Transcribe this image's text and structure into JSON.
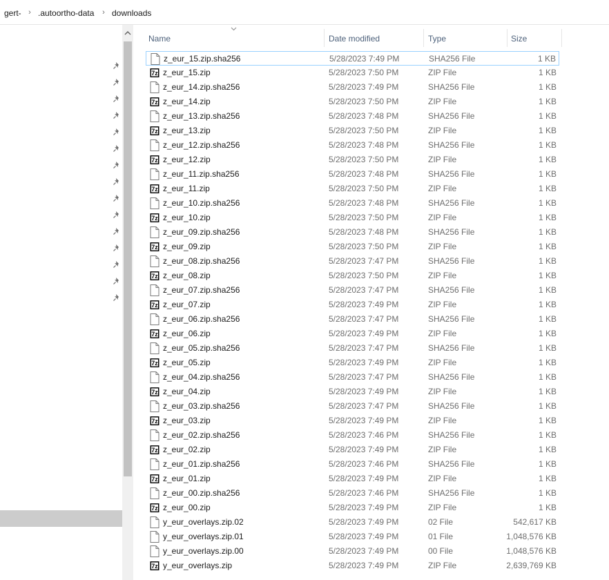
{
  "breadcrumb": [
    "gert-",
    ".autoortho-data",
    "downloads"
  ],
  "columns": {
    "name": "Name",
    "date": "Date modified",
    "type": "Type",
    "size": "Size"
  },
  "files": [
    {
      "name": "z_eur_15.zip.sha256",
      "date": "5/28/2023 7:49 PM",
      "type": "SHA256 File",
      "size": "1 KB",
      "icon": "generic-file-icon"
    },
    {
      "name": "z_eur_15.zip",
      "date": "5/28/2023 7:50 PM",
      "type": "ZIP File",
      "size": "1 KB",
      "icon": "7zip-archive-icon"
    },
    {
      "name": "z_eur_14.zip.sha256",
      "date": "5/28/2023 7:49 PM",
      "type": "SHA256 File",
      "size": "1 KB",
      "icon": "generic-file-icon"
    },
    {
      "name": "z_eur_14.zip",
      "date": "5/28/2023 7:50 PM",
      "type": "ZIP File",
      "size": "1 KB",
      "icon": "7zip-archive-icon"
    },
    {
      "name": "z_eur_13.zip.sha256",
      "date": "5/28/2023 7:48 PM",
      "type": "SHA256 File",
      "size": "1 KB",
      "icon": "generic-file-icon"
    },
    {
      "name": "z_eur_13.zip",
      "date": "5/28/2023 7:50 PM",
      "type": "ZIP File",
      "size": "1 KB",
      "icon": "7zip-archive-icon"
    },
    {
      "name": "z_eur_12.zip.sha256",
      "date": "5/28/2023 7:48 PM",
      "type": "SHA256 File",
      "size": "1 KB",
      "icon": "generic-file-icon"
    },
    {
      "name": "z_eur_12.zip",
      "date": "5/28/2023 7:50 PM",
      "type": "ZIP File",
      "size": "1 KB",
      "icon": "7zip-archive-icon"
    },
    {
      "name": "z_eur_11.zip.sha256",
      "date": "5/28/2023 7:48 PM",
      "type": "SHA256 File",
      "size": "1 KB",
      "icon": "generic-file-icon"
    },
    {
      "name": "z_eur_11.zip",
      "date": "5/28/2023 7:50 PM",
      "type": "ZIP File",
      "size": "1 KB",
      "icon": "7zip-archive-icon"
    },
    {
      "name": "z_eur_10.zip.sha256",
      "date": "5/28/2023 7:48 PM",
      "type": "SHA256 File",
      "size": "1 KB",
      "icon": "generic-file-icon"
    },
    {
      "name": "z_eur_10.zip",
      "date": "5/28/2023 7:50 PM",
      "type": "ZIP File",
      "size": "1 KB",
      "icon": "7zip-archive-icon"
    },
    {
      "name": "z_eur_09.zip.sha256",
      "date": "5/28/2023 7:48 PM",
      "type": "SHA256 File",
      "size": "1 KB",
      "icon": "generic-file-icon"
    },
    {
      "name": "z_eur_09.zip",
      "date": "5/28/2023 7:50 PM",
      "type": "ZIP File",
      "size": "1 KB",
      "icon": "7zip-archive-icon"
    },
    {
      "name": "z_eur_08.zip.sha256",
      "date": "5/28/2023 7:47 PM",
      "type": "SHA256 File",
      "size": "1 KB",
      "icon": "generic-file-icon"
    },
    {
      "name": "z_eur_08.zip",
      "date": "5/28/2023 7:50 PM",
      "type": "ZIP File",
      "size": "1 KB",
      "icon": "7zip-archive-icon"
    },
    {
      "name": "z_eur_07.zip.sha256",
      "date": "5/28/2023 7:47 PM",
      "type": "SHA256 File",
      "size": "1 KB",
      "icon": "generic-file-icon"
    },
    {
      "name": "z_eur_07.zip",
      "date": "5/28/2023 7:49 PM",
      "type": "ZIP File",
      "size": "1 KB",
      "icon": "7zip-archive-icon"
    },
    {
      "name": "z_eur_06.zip.sha256",
      "date": "5/28/2023 7:47 PM",
      "type": "SHA256 File",
      "size": "1 KB",
      "icon": "generic-file-icon"
    },
    {
      "name": "z_eur_06.zip",
      "date": "5/28/2023 7:49 PM",
      "type": "ZIP File",
      "size": "1 KB",
      "icon": "7zip-archive-icon"
    },
    {
      "name": "z_eur_05.zip.sha256",
      "date": "5/28/2023 7:47 PM",
      "type": "SHA256 File",
      "size": "1 KB",
      "icon": "generic-file-icon"
    },
    {
      "name": "z_eur_05.zip",
      "date": "5/28/2023 7:49 PM",
      "type": "ZIP File",
      "size": "1 KB",
      "icon": "7zip-archive-icon"
    },
    {
      "name": "z_eur_04.zip.sha256",
      "date": "5/28/2023 7:47 PM",
      "type": "SHA256 File",
      "size": "1 KB",
      "icon": "generic-file-icon"
    },
    {
      "name": "z_eur_04.zip",
      "date": "5/28/2023 7:49 PM",
      "type": "ZIP File",
      "size": "1 KB",
      "icon": "7zip-archive-icon"
    },
    {
      "name": "z_eur_03.zip.sha256",
      "date": "5/28/2023 7:47 PM",
      "type": "SHA256 File",
      "size": "1 KB",
      "icon": "generic-file-icon"
    },
    {
      "name": "z_eur_03.zip",
      "date": "5/28/2023 7:49 PM",
      "type": "ZIP File",
      "size": "1 KB",
      "icon": "7zip-archive-icon"
    },
    {
      "name": "z_eur_02.zip.sha256",
      "date": "5/28/2023 7:46 PM",
      "type": "SHA256 File",
      "size": "1 KB",
      "icon": "generic-file-icon"
    },
    {
      "name": "z_eur_02.zip",
      "date": "5/28/2023 7:49 PM",
      "type": "ZIP File",
      "size": "1 KB",
      "icon": "7zip-archive-icon"
    },
    {
      "name": "z_eur_01.zip.sha256",
      "date": "5/28/2023 7:46 PM",
      "type": "SHA256 File",
      "size": "1 KB",
      "icon": "generic-file-icon"
    },
    {
      "name": "z_eur_01.zip",
      "date": "5/28/2023 7:49 PM",
      "type": "ZIP File",
      "size": "1 KB",
      "icon": "7zip-archive-icon"
    },
    {
      "name": "z_eur_00.zip.sha256",
      "date": "5/28/2023 7:46 PM",
      "type": "SHA256 File",
      "size": "1 KB",
      "icon": "generic-file-icon"
    },
    {
      "name": "z_eur_00.zip",
      "date": "5/28/2023 7:49 PM",
      "type": "ZIP File",
      "size": "1 KB",
      "icon": "7zip-archive-icon"
    },
    {
      "name": "y_eur_overlays.zip.02",
      "date": "5/28/2023 7:49 PM",
      "type": "02 File",
      "size": "542,617 KB",
      "icon": "generic-file-icon"
    },
    {
      "name": "y_eur_overlays.zip.01",
      "date": "5/28/2023 7:49 PM",
      "type": "01 File",
      "size": "1,048,576 KB",
      "icon": "generic-file-icon"
    },
    {
      "name": "y_eur_overlays.zip.00",
      "date": "5/28/2023 7:49 PM",
      "type": "00 File",
      "size": "1,048,576 KB",
      "icon": "generic-file-icon"
    },
    {
      "name": "y_eur_overlays.zip",
      "date": "5/28/2023 7:49 PM",
      "type": "ZIP File",
      "size": "2,639,769 KB",
      "icon": "7zip-archive-icon"
    }
  ]
}
